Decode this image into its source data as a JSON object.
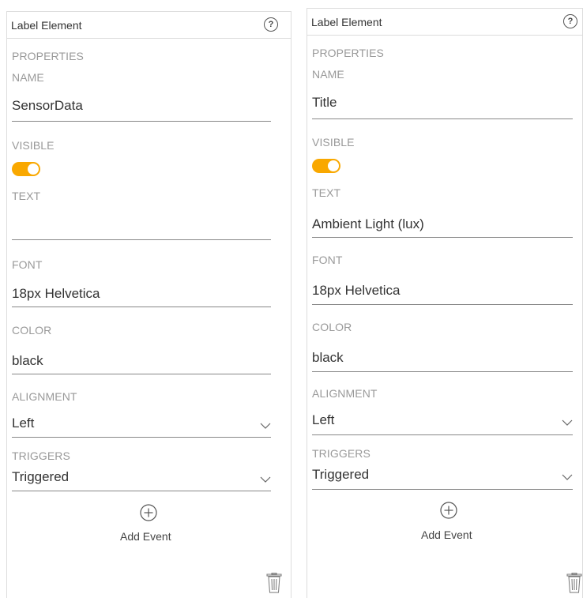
{
  "panels": [
    {
      "header_title": "Label Element",
      "help_icon": "?",
      "properties_label": "PROPERTIES",
      "name_label": "NAME",
      "name_value": "SensorData",
      "visible_label": "VISIBLE",
      "visible_on": true,
      "text_label": "TEXT",
      "text_value": "",
      "font_label": "FONT",
      "font_value": "18px Helvetica",
      "color_label": "COLOR",
      "color_value": "black",
      "alignment_label": "ALIGNMENT",
      "alignment_value": "Left",
      "triggers_label": "TRIGGERS",
      "triggers_value": "Triggered",
      "add_event_label": "Add Event"
    },
    {
      "header_title": "Label Element",
      "help_icon": "?",
      "properties_label": "PROPERTIES",
      "name_label": "NAME",
      "name_value": "Title",
      "visible_label": "VISIBLE",
      "visible_on": true,
      "text_label": "TEXT",
      "text_value": "Ambient Light (lux)",
      "font_label": "FONT",
      "font_value": "18px Helvetica",
      "color_label": "COLOR",
      "color_value": "black",
      "alignment_label": "ALIGNMENT",
      "alignment_value": "Left",
      "triggers_label": "TRIGGERS",
      "triggers_value": "Triggered",
      "add_event_label": "Add Event"
    }
  ],
  "colors": {
    "toggle_on": "#f9a800",
    "border": "#dcdcdc",
    "label": "#999999"
  },
  "icons": [
    "help-icon",
    "chevron-down-icon",
    "add-circle-icon",
    "trash-icon"
  ]
}
